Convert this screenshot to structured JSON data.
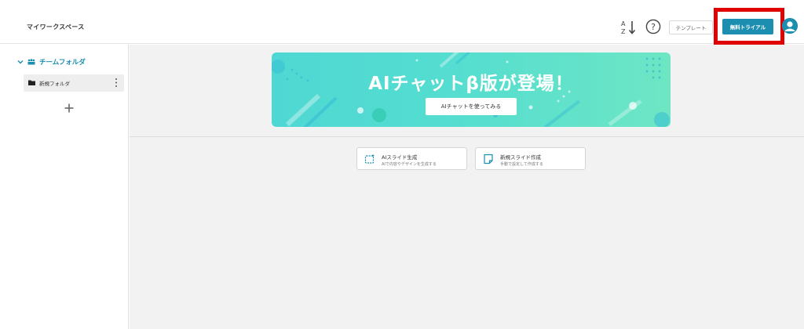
{
  "header": {
    "workspace_title": "マイワークスペース",
    "template_label": "テンプレート",
    "trial_label": "無料トライアル"
  },
  "sidebar": {
    "team_folder_label": "チームフォルダ",
    "folders": [
      {
        "label": "新規フォルダ"
      }
    ]
  },
  "banner": {
    "title": "AIチャットβ版が登場！",
    "cta_label": "AIチャットを使ってみる"
  },
  "actions": [
    {
      "title": "AIスライド生成",
      "subtitle": "AIで内容やデザインを生成する",
      "icon": "ai-slide-icon"
    },
    {
      "title": "新規スライド作成",
      "subtitle": "手動で設定して作成する",
      "icon": "new-slide-icon"
    }
  ],
  "colors": {
    "accent": "#1c8eb0",
    "highlight": "#e00000",
    "banner_start": "#4fd8d3",
    "banner_end": "#6ee6c4"
  }
}
